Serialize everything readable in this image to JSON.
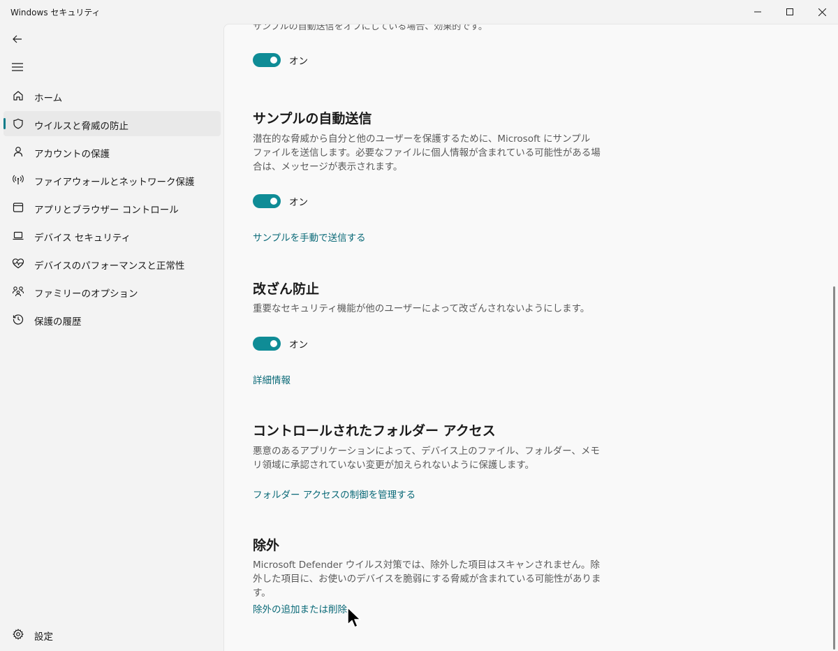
{
  "window": {
    "title": "Windows セキュリティ",
    "controls": [
      "minimize-icon",
      "maximize-icon",
      "close-icon"
    ]
  },
  "sidebar": {
    "back_icon": "back-arrow-icon",
    "menu_icon": "hamburger-icon",
    "items": [
      {
        "label": "ホーム",
        "icon": "home-icon",
        "active": false
      },
      {
        "label": "ウイルスと脅威の防止",
        "icon": "shield-icon",
        "active": true
      },
      {
        "label": "アカウントの保護",
        "icon": "person-icon",
        "active": false
      },
      {
        "label": "ファイアウォールとネットワーク保護",
        "icon": "antenna-icon",
        "active": false
      },
      {
        "label": "アプリとブラウザー コントロール",
        "icon": "app-window-icon",
        "active": false
      },
      {
        "label": "デバイス セキュリティ",
        "icon": "laptop-icon",
        "active": false
      },
      {
        "label": "デバイスのパフォーマンスと正常性",
        "icon": "heart-pulse-icon",
        "active": false
      },
      {
        "label": "ファミリーのオプション",
        "icon": "family-icon",
        "active": false
      },
      {
        "label": "保護の履歴",
        "icon": "history-icon",
        "active": false
      }
    ],
    "settings": {
      "label": "設定",
      "icon": "gear-icon"
    }
  },
  "main": {
    "cut_off_text": "サンプルの自動送信をオフにしている場合、効果的です。",
    "toggle1": {
      "label": "オン",
      "on": true
    },
    "sample_submission": {
      "title": "サンプルの自動送信",
      "desc": "潜在的な脅威から自分と他のユーザーを保護するために、Microsoft にサンプル ファイルを送信します。必要なファイルに個人情報が含まれている可能性がある場合は、メッセージが表示されます。",
      "toggle_label": "オン",
      "link": "サンプルを手動で送信する"
    },
    "tamper_protection": {
      "title": "改ざん防止",
      "desc": "重要なセキュリティ機能が他のユーザーによって改ざんされないようにします。",
      "toggle_label": "オン",
      "link": "詳細情報"
    },
    "controlled_folder": {
      "title": "コントロールされたフォルダー アクセス",
      "desc": "悪意のあるアプリケーションによって、デバイス上のファイル、フォルダー、メモリ領域に承認されていない変更が加えられないように保護します。",
      "link": "フォルダー アクセスの制御を管理する"
    },
    "exclusions": {
      "title": "除外",
      "desc": "Microsoft Defender ウイルス対策では、除外した項目はスキャンされません。除外した項目に、お使いのデバイスを脆弱にする脅威が含まれている可能性があります。",
      "link": "除外の追加または削除"
    }
  },
  "colors": {
    "accent": "#0f8c96",
    "link": "#0b6a78",
    "sidebar_bg": "#f3f3f3",
    "content_bg": "#f9f9f9"
  }
}
